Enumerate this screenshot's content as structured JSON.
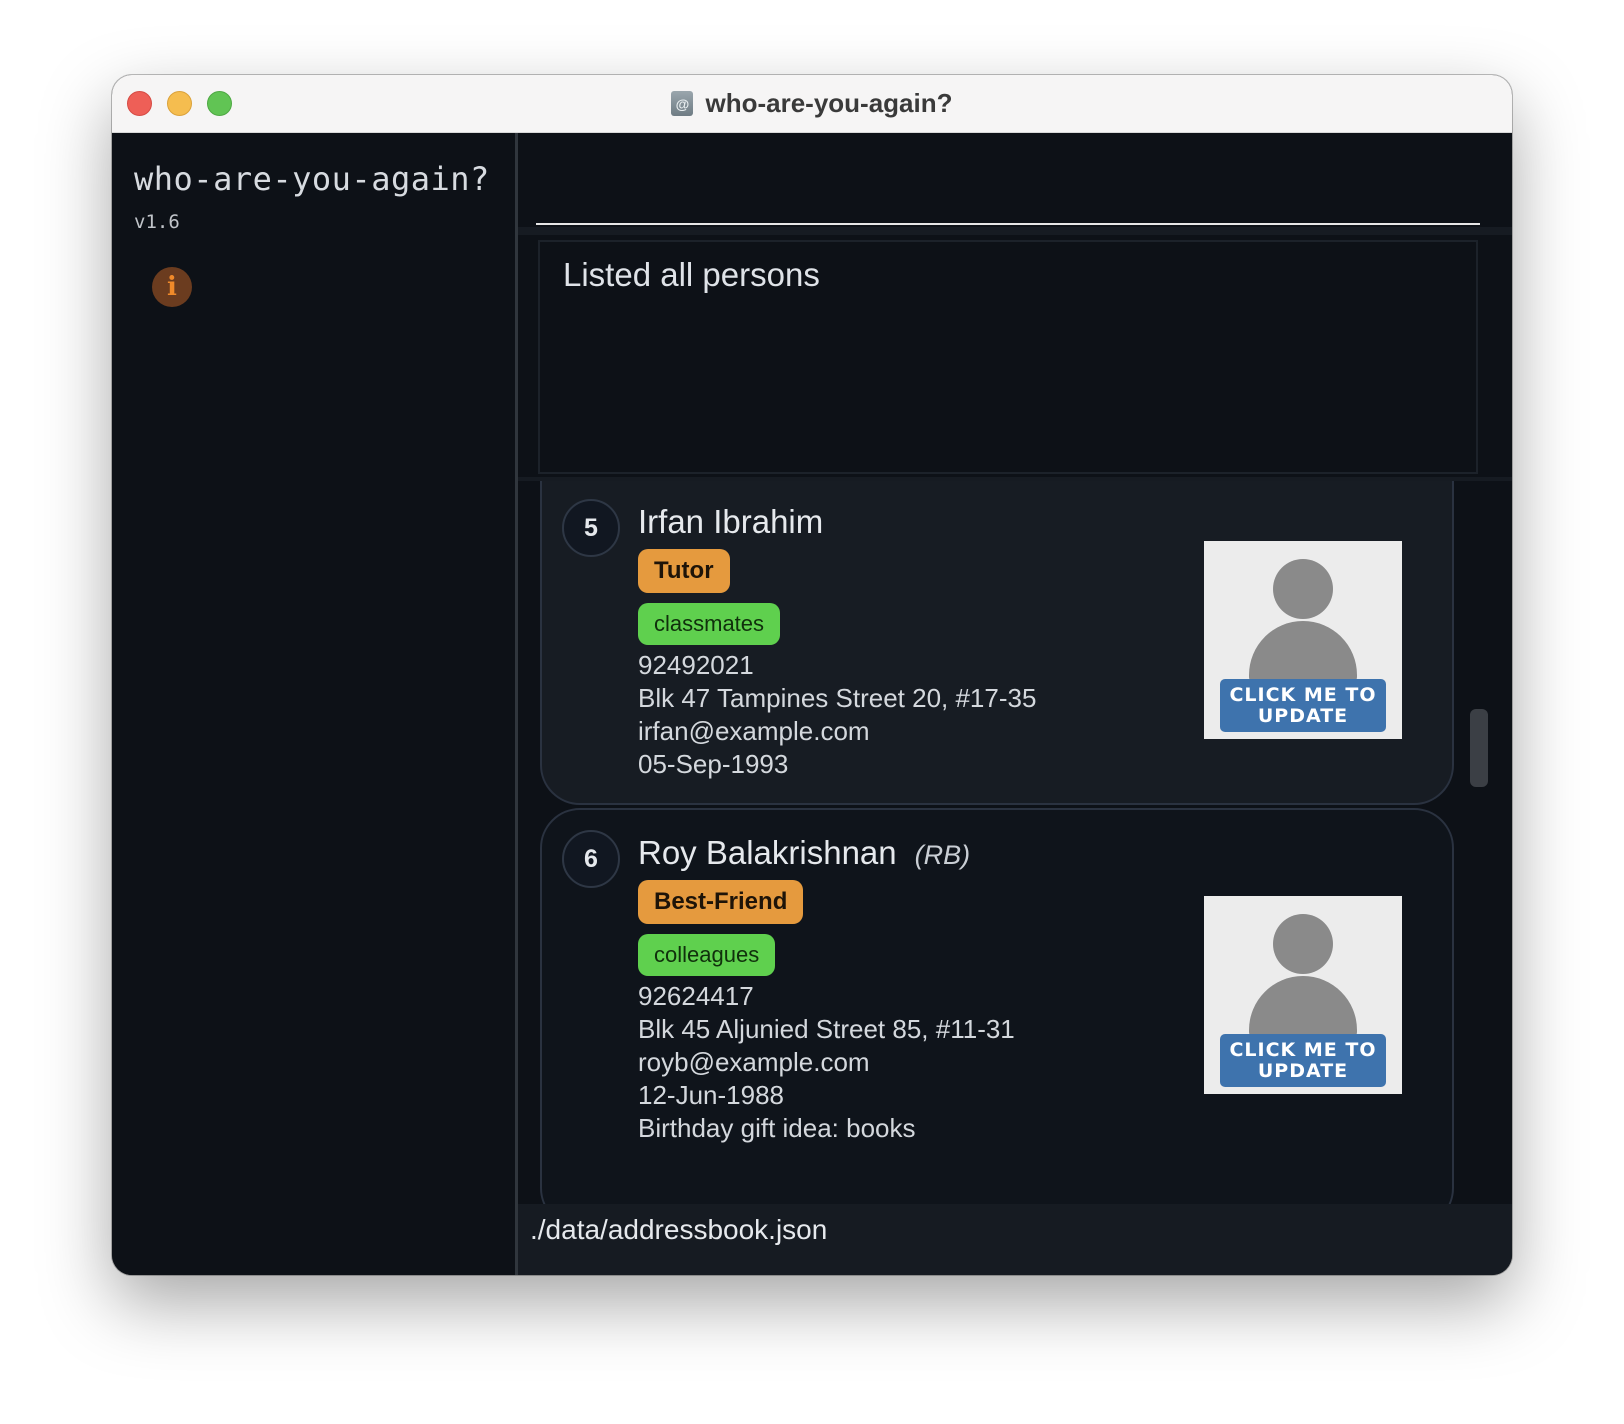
{
  "window": {
    "title": "who-are-you-again?",
    "icon": "address-book-icon"
  },
  "sidebar": {
    "app_name": "who-are-you-again?",
    "version": "v1.6",
    "info_icon": "info-icon",
    "info_glyph": "i"
  },
  "command": {
    "value": ""
  },
  "result": {
    "message": "Listed all persons"
  },
  "persons": [
    {
      "index": "5",
      "name": "Irfan Ibrahim",
      "nickname": "",
      "role": "Tutor",
      "group": "classmates",
      "phone": "92492021",
      "address": "Blk 47 Tampines Street 20, #17-35",
      "email": "irfan@example.com",
      "birthday": "05-Sep-1993",
      "note": "",
      "photo_button": "CLICK ME TO UPDATE"
    },
    {
      "index": "6",
      "name": "Roy Balakrishnan",
      "nickname": "(RB)",
      "role": "Best-Friend",
      "group": "colleagues",
      "phone": "92624417",
      "address": "Blk 45 Aljunied Street 85, #11-31",
      "email": "royb@example.com",
      "birthday": "12-Jun-1988",
      "note": "Birthday gift idea: books",
      "photo_button": "CLICK ME TO UPDATE"
    }
  ],
  "status": {
    "path": "./data/addressbook.json"
  },
  "colors": {
    "background": "#0d1117",
    "card": "#171c23",
    "role_tag": "#e59a3e",
    "group_tag": "#5fd04e",
    "update_button": "#3e73ad",
    "info_button": "#6b3c1f"
  }
}
